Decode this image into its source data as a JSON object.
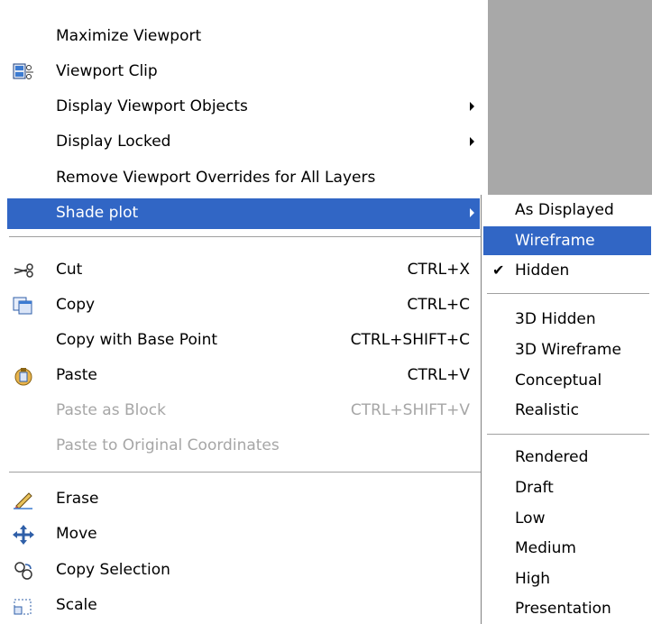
{
  "menu": {
    "items": [
      {
        "label": "Maximize Viewport",
        "shortcut": "",
        "disabled": false,
        "submenu": false
      },
      {
        "label": "Viewport Clip",
        "shortcut": "",
        "disabled": false,
        "submenu": false,
        "icon": "viewport-clip-icon"
      },
      {
        "label": "Display Viewport Objects",
        "shortcut": "",
        "disabled": false,
        "submenu": true
      },
      {
        "label": "Display Locked",
        "shortcut": "",
        "disabled": false,
        "submenu": true
      },
      {
        "label": "Remove Viewport Overrides for All Layers",
        "shortcut": "",
        "disabled": false,
        "submenu": false
      },
      {
        "label": "Shade plot",
        "shortcut": "",
        "disabled": false,
        "submenu": true,
        "selected": true
      },
      {
        "label": "Cut",
        "shortcut": "CTRL+X",
        "disabled": false,
        "icon": "scissors-icon"
      },
      {
        "label": "Copy",
        "shortcut": "CTRL+C",
        "disabled": false,
        "icon": "copy-icon"
      },
      {
        "label": "Copy with Base Point",
        "shortcut": "CTRL+SHIFT+C",
        "disabled": false
      },
      {
        "label": "Paste",
        "shortcut": "CTRL+V",
        "disabled": false,
        "icon": "paste-icon"
      },
      {
        "label": "Paste as Block",
        "shortcut": "CTRL+SHIFT+V",
        "disabled": true
      },
      {
        "label": "Paste to Original Coordinates",
        "shortcut": "",
        "disabled": true
      },
      {
        "label": "Erase",
        "shortcut": "",
        "disabled": false,
        "icon": "eraser-pencil-icon"
      },
      {
        "label": "Move",
        "shortcut": "",
        "disabled": false,
        "icon": "move-arrows-icon"
      },
      {
        "label": "Copy Selection",
        "shortcut": "",
        "disabled": false,
        "icon": "copy-selection-icon"
      },
      {
        "label": "Scale",
        "shortcut": "",
        "disabled": false,
        "icon": "scale-icon"
      }
    ]
  },
  "submenu": {
    "items": [
      {
        "label": "As Displayed",
        "checked": false
      },
      {
        "label": "Wireframe",
        "checked": false,
        "selected": true
      },
      {
        "label": "Hidden",
        "checked": true
      },
      {
        "label": "3D Hidden"
      },
      {
        "label": "3D Wireframe"
      },
      {
        "label": "Conceptual"
      },
      {
        "label": "Realistic"
      },
      {
        "label": "Rendered"
      },
      {
        "label": "Draft"
      },
      {
        "label": "Low"
      },
      {
        "label": "Medium"
      },
      {
        "label": "High"
      },
      {
        "label": "Presentation"
      }
    ],
    "check_mark": "✔"
  },
  "colors": {
    "highlight": "#3166c5",
    "disabled": "#a6a6a6",
    "backdrop": "#a8a8a8"
  }
}
